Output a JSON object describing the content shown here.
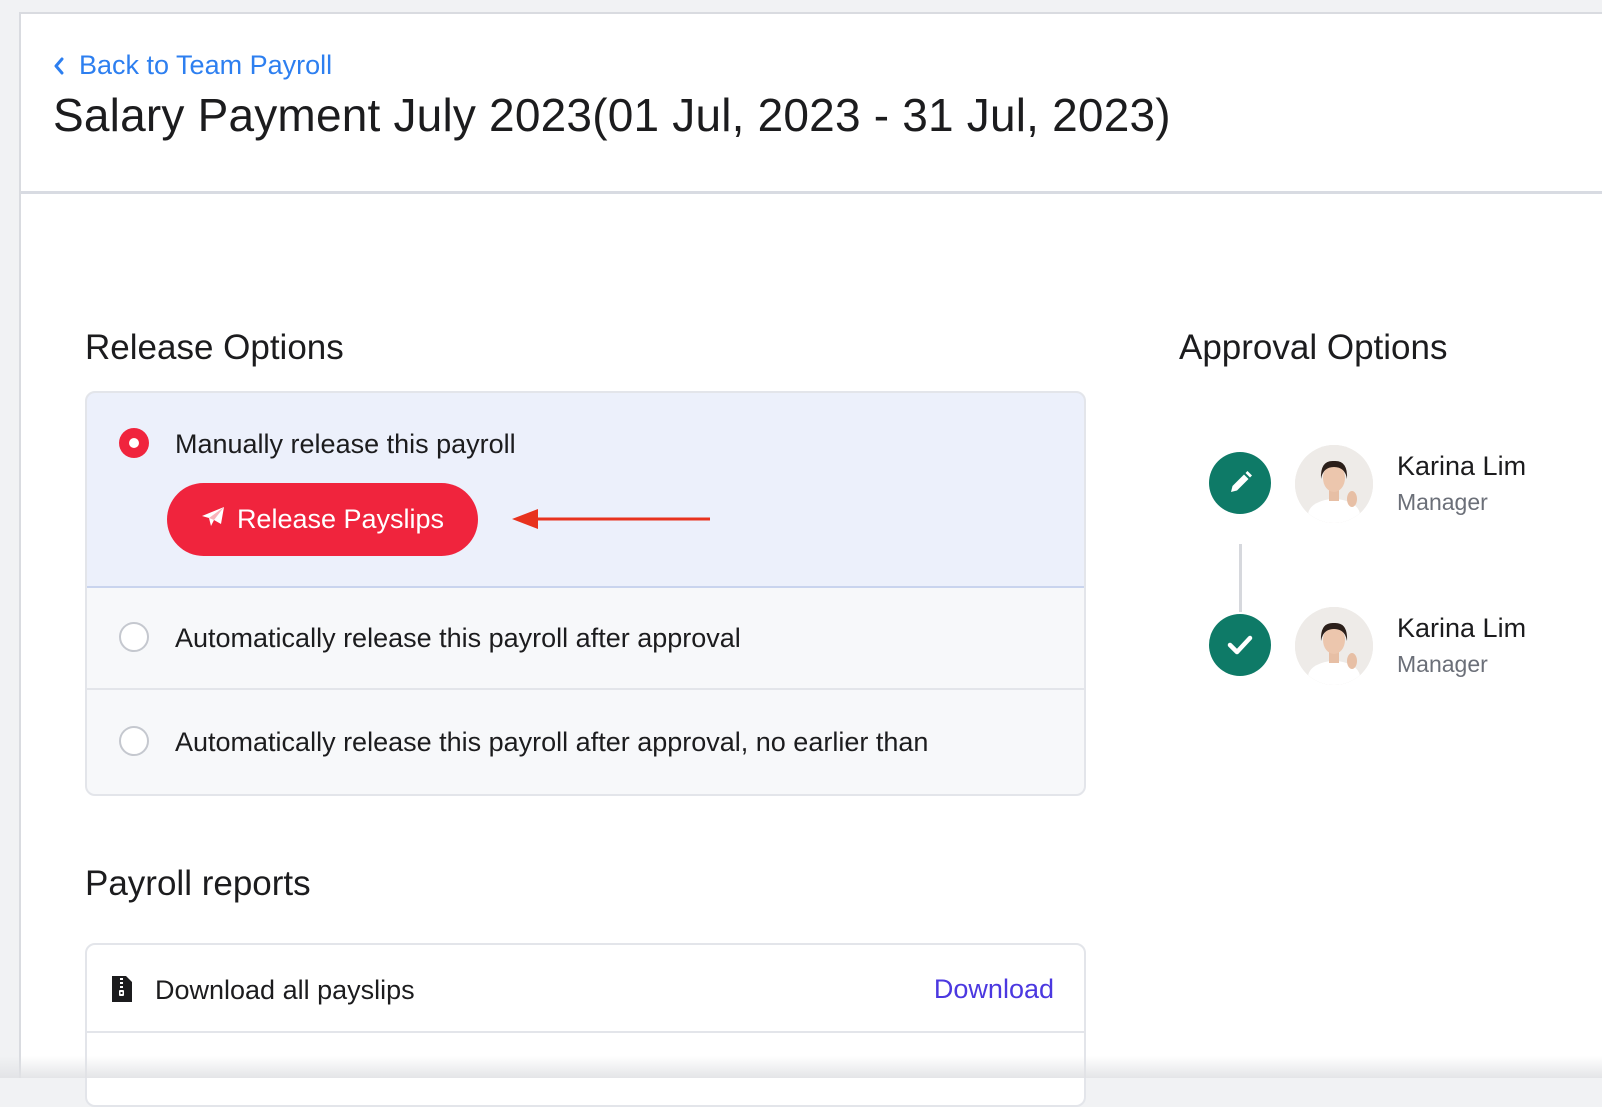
{
  "header": {
    "back_label": "Back to Team Payroll",
    "title": "Salary Payment July 2023(01 Jul, 2023 - 31 Jul, 2023)"
  },
  "release_options": {
    "title": "Release Options",
    "options": [
      {
        "label": "Manually release this payroll",
        "selected": true
      },
      {
        "label": "Automatically release this payroll after approval",
        "selected": false
      },
      {
        "label": "Automatically release this payroll after approval, no earlier than",
        "selected": false
      }
    ],
    "release_button_label": "Release Payslips"
  },
  "approval_options": {
    "title": "Approval Options",
    "approvers": [
      {
        "name": "Karina Lim",
        "role": "Manager",
        "status_icon": "pencil-icon"
      },
      {
        "name": "Karina Lim",
        "role": "Manager",
        "status_icon": "check-icon"
      }
    ]
  },
  "payroll_reports": {
    "title": "Payroll reports",
    "items": [
      {
        "label": "Download all payslips",
        "action": "Download",
        "icon": "zip-file-icon"
      }
    ]
  },
  "colors": {
    "accent_red": "#f0243d",
    "link_blue": "#2d7ff0",
    "download_purple": "#4b38e0",
    "approval_green": "#0e7a67"
  }
}
